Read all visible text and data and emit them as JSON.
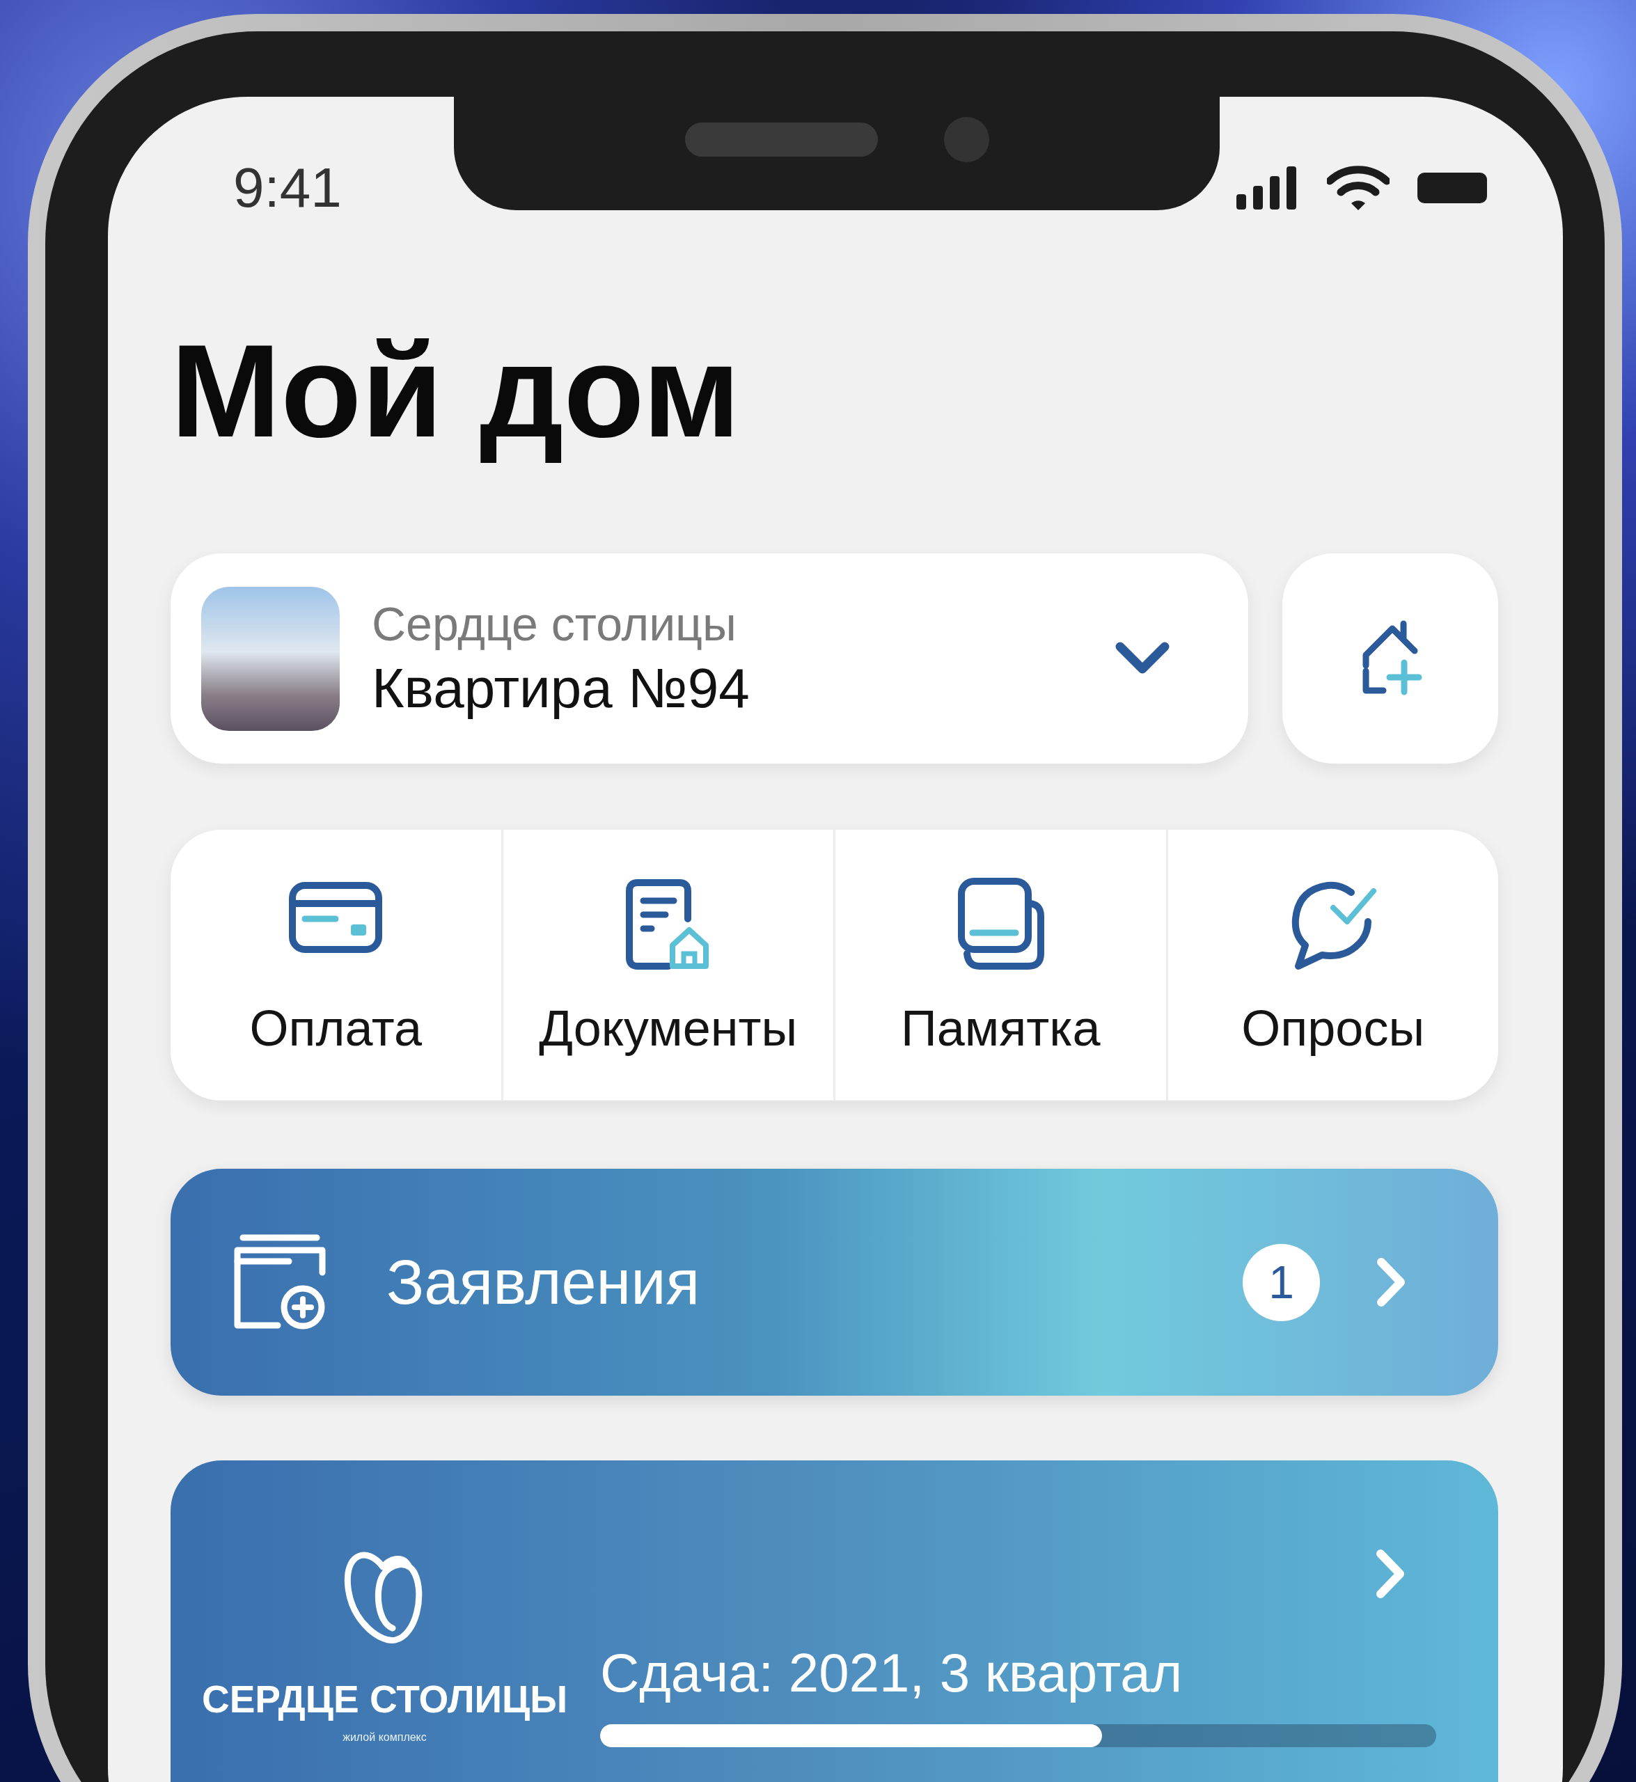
{
  "status_bar": {
    "time": "9:41"
  },
  "title": "Мой дом",
  "property_selector": {
    "project": "Сердце столицы",
    "apartment": "Квартира №94"
  },
  "quick_actions": [
    {
      "kind": "payment",
      "label": "Оплата"
    },
    {
      "kind": "documents",
      "label": "Документы"
    },
    {
      "kind": "memo",
      "label": "Памятка"
    },
    {
      "kind": "surveys",
      "label": "Опросы"
    }
  ],
  "applications_banner": {
    "label": "Заявления",
    "badge": "1"
  },
  "project_card": {
    "logo_name": "СЕРДЦЕ СТОЛИЦЫ",
    "logo_subtitle": "жилой комплекс",
    "completion": "Сдача: 2021, 3 квартал",
    "progress": {
      "level": 0.6
    }
  }
}
